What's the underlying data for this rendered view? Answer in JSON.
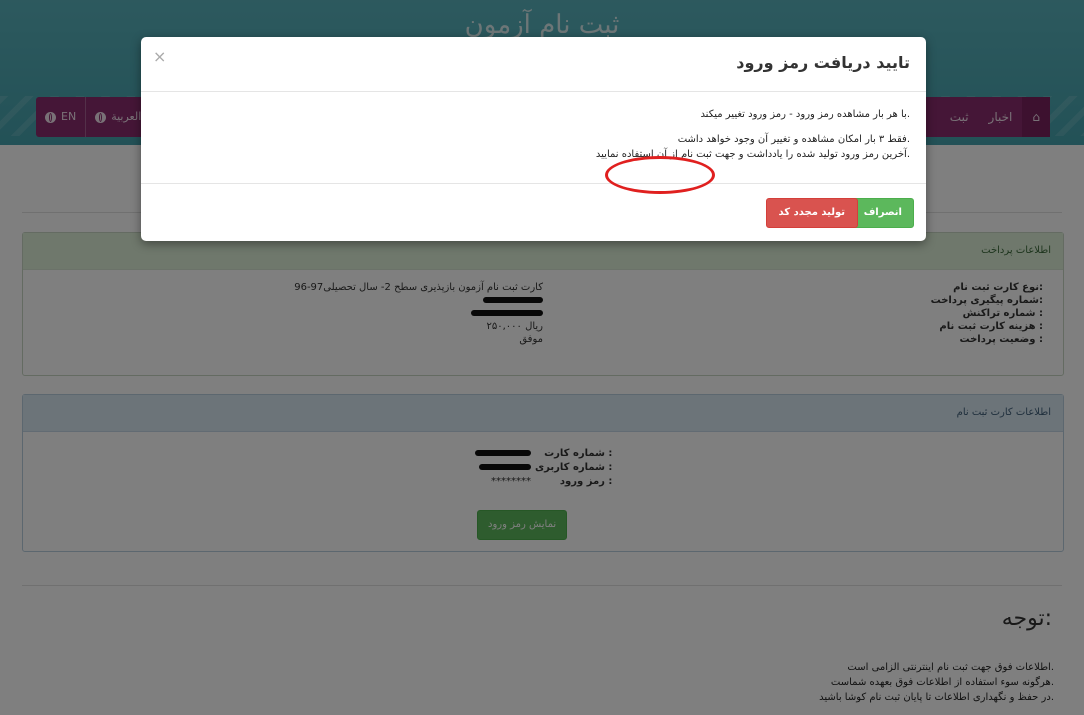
{
  "header": {
    "site_title": "ثبت نام آزمون"
  },
  "nav": {
    "home_label": "",
    "items": [
      "اخبار",
      "ثبت"
    ],
    "languages": [
      "EN",
      "العربية"
    ]
  },
  "payment_panel": {
    "heading": "اطلاعات پرداخت",
    "labels": [
      "نوع کارت ثبت نام:",
      "شماره پیگیری پرداخت:",
      "شماره تراکنش :",
      "هزینه کارت ثبت نام :",
      "وضعیت پرداخت :"
    ],
    "card_type": "کارت ثبت نام آزمون بازپذیری سطح 2- سال تحصیلی97-96",
    "fee": "۲۵۰,۰۰۰ ریال",
    "status": "موفق"
  },
  "card_panel": {
    "heading": "اطلاعات کارت ثبت نام",
    "labels": [
      "شماره کارت :",
      "شماره کاربری :",
      "رمز ورود :"
    ],
    "password_masked": "********",
    "show_password_button": "نمایش رمز ورود"
  },
  "notice": {
    "title": "توجه:",
    "lines": [
      "اطلاعات فوق جهت ثبت نام اینترنتی الزامی است.",
      "هرگونه سوء استفاده از اطلاعات فوق بعهده شماست.",
      "در حفظ و نگهداری اطلاعات تا پایان ثبت نام کوشا باشید."
    ]
  },
  "modal": {
    "title": "تایید دریافت رمز ورود",
    "close_symbol": "×",
    "line1": "با هر بار مشاهده رمز ورود - رمز ورود تغییر میکند.",
    "line2": "فقط ۳ بار امکان مشاهده و تغییر آن وجود خواهد داشت.",
    "line3": "آخرین رمز ورود تولید شده را یادداشت و جهت ثبت نام از آن استفاده نمایید.",
    "cancel_button": "انصراف",
    "regenerate_button": "تولید مجدد کد"
  },
  "colors": {
    "header_teal": "#4ea9b4",
    "nav_purple": "#8a2c6e",
    "success_green": "#5cb85c",
    "danger_red": "#d9534f",
    "highlight_circle": "#e0201f"
  }
}
